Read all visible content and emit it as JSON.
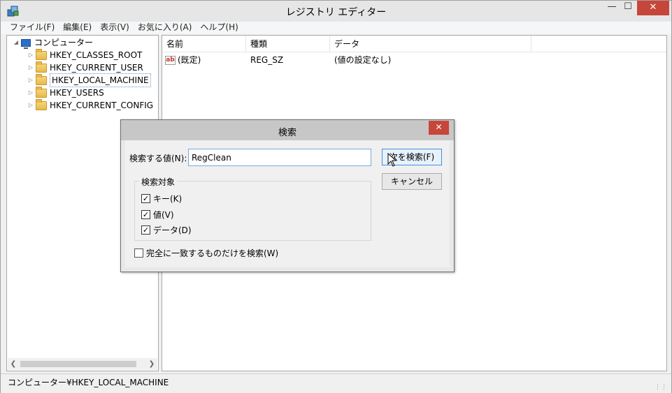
{
  "window": {
    "title": "レジストリ エディター",
    "minimize_glyph": "—",
    "maximize_glyph": "☐",
    "close_glyph": "✕"
  },
  "menu": [
    "ファイル(F)",
    "編集(E)",
    "表示(V)",
    "お気に入り(A)",
    "ヘルプ(H)"
  ],
  "tree": {
    "root": "コンピューター",
    "keys": [
      "HKEY_CLASSES_ROOT",
      "HKEY_CURRENT_USER",
      "HKEY_LOCAL_MACHINE",
      "HKEY_USERS",
      "HKEY_CURRENT_CONFIG"
    ],
    "selected": "HKEY_LOCAL_MACHINE"
  },
  "list": {
    "columns": [
      "名前",
      "種類",
      "データ"
    ],
    "rows": [
      {
        "name": "(既定)",
        "type": "REG_SZ",
        "data": "(値の設定なし)"
      }
    ]
  },
  "status": "コンピューター¥HKEY_LOCAL_MACHINE",
  "dialog": {
    "title": "検索",
    "close_glyph": "✕",
    "find_label": "検索する値(N):",
    "find_value": "RegClean",
    "find_next_label": "次を検索(F)",
    "cancel_label": "キャンセル",
    "group_label": "検索対象",
    "options": [
      {
        "label": "キー(K)",
        "checked": true
      },
      {
        "label": "値(V)",
        "checked": true
      },
      {
        "label": "データ(D)",
        "checked": true
      }
    ],
    "whole_match_label": "完全に一致するものだけを検索(W)",
    "whole_match_checked": false
  },
  "icons": {
    "app": "registry-editor-icon",
    "computer": "computer-icon",
    "folder": "folder-icon",
    "string_value": "string-value-icon",
    "cursor": "mouse-cursor-icon"
  }
}
